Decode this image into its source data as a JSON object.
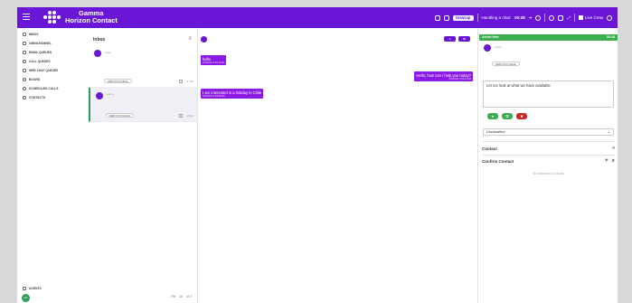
{
  "header": {
    "brand_line1": "Gamma",
    "brand_line2": "Horizon Contact",
    "status_label": "Unwrap",
    "handling_label": "Handling a chat:",
    "handling_time": "00:28",
    "user_label": "Live Crew",
    "colors": {
      "primary": "#6a16d6",
      "success": "#3cae4e",
      "danger": "#c62828"
    }
  },
  "sidebar": {
    "items": [
      {
        "label": "INBOX",
        "icon": "inbox-icon",
        "count": "0"
      },
      {
        "label": "OMNICHANNEL",
        "icon": "omnichannel-icon"
      },
      {
        "label": "EMAIL QUEUES",
        "icon": "email-icon"
      },
      {
        "label": "CALL QUEUES",
        "icon": "phone-icon"
      },
      {
        "label": "WEB CHAT QUEUES",
        "icon": "chat-icon"
      },
      {
        "label": "BOARD",
        "icon": "board-icon"
      },
      {
        "label": "SCHEDULED CALLS",
        "icon": "clock-icon"
      },
      {
        "label": "CONTACTS",
        "icon": "contacts-icon"
      }
    ],
    "agents_label": "AGENTS",
    "avatar_initials": "LC"
  },
  "inbox": {
    "title": "Inbox",
    "cards": [
      {
        "name": "Xuqy",
        "tag": "WEB CHAT QUEUE",
        "time": "1 h53"
      },
      {
        "name": "Laboy",
        "tag": "WEB CHAT QUEUE",
        "time": "15:42"
      }
    ],
    "pager": {
      "page_label": "Fitt",
      "per_page": "10",
      "range": "of 2"
    }
  },
  "conversation": {
    "btn1": "●",
    "btn2": "✖",
    "messages": [
      {
        "text": "hello",
        "time": "2/24/2021 2:53:14 AM",
        "dir": "in"
      },
      {
        "text": "Hello, how can I help you today?",
        "time": "2/24/2021 2:53:19 AM",
        "dir": "out"
      },
      {
        "text": "I am interested in a holiday in Chile",
        "time": "2/24/2021 2:53:53 AM",
        "dir": "in"
      }
    ]
  },
  "right_panel": {
    "active_label": "Active item",
    "active_time": "00:28",
    "name": "Laboy",
    "tag": "WEB CHAT QUEUE",
    "reply_text": "Let me look at what we have available",
    "actions": [
      "➤",
      "⧉",
      "✖"
    ],
    "disposition": "Unclassified",
    "contact_label": "Contact",
    "confirm_label": "Confirm Contact",
    "empty_text": "No Matched Contacts"
  }
}
